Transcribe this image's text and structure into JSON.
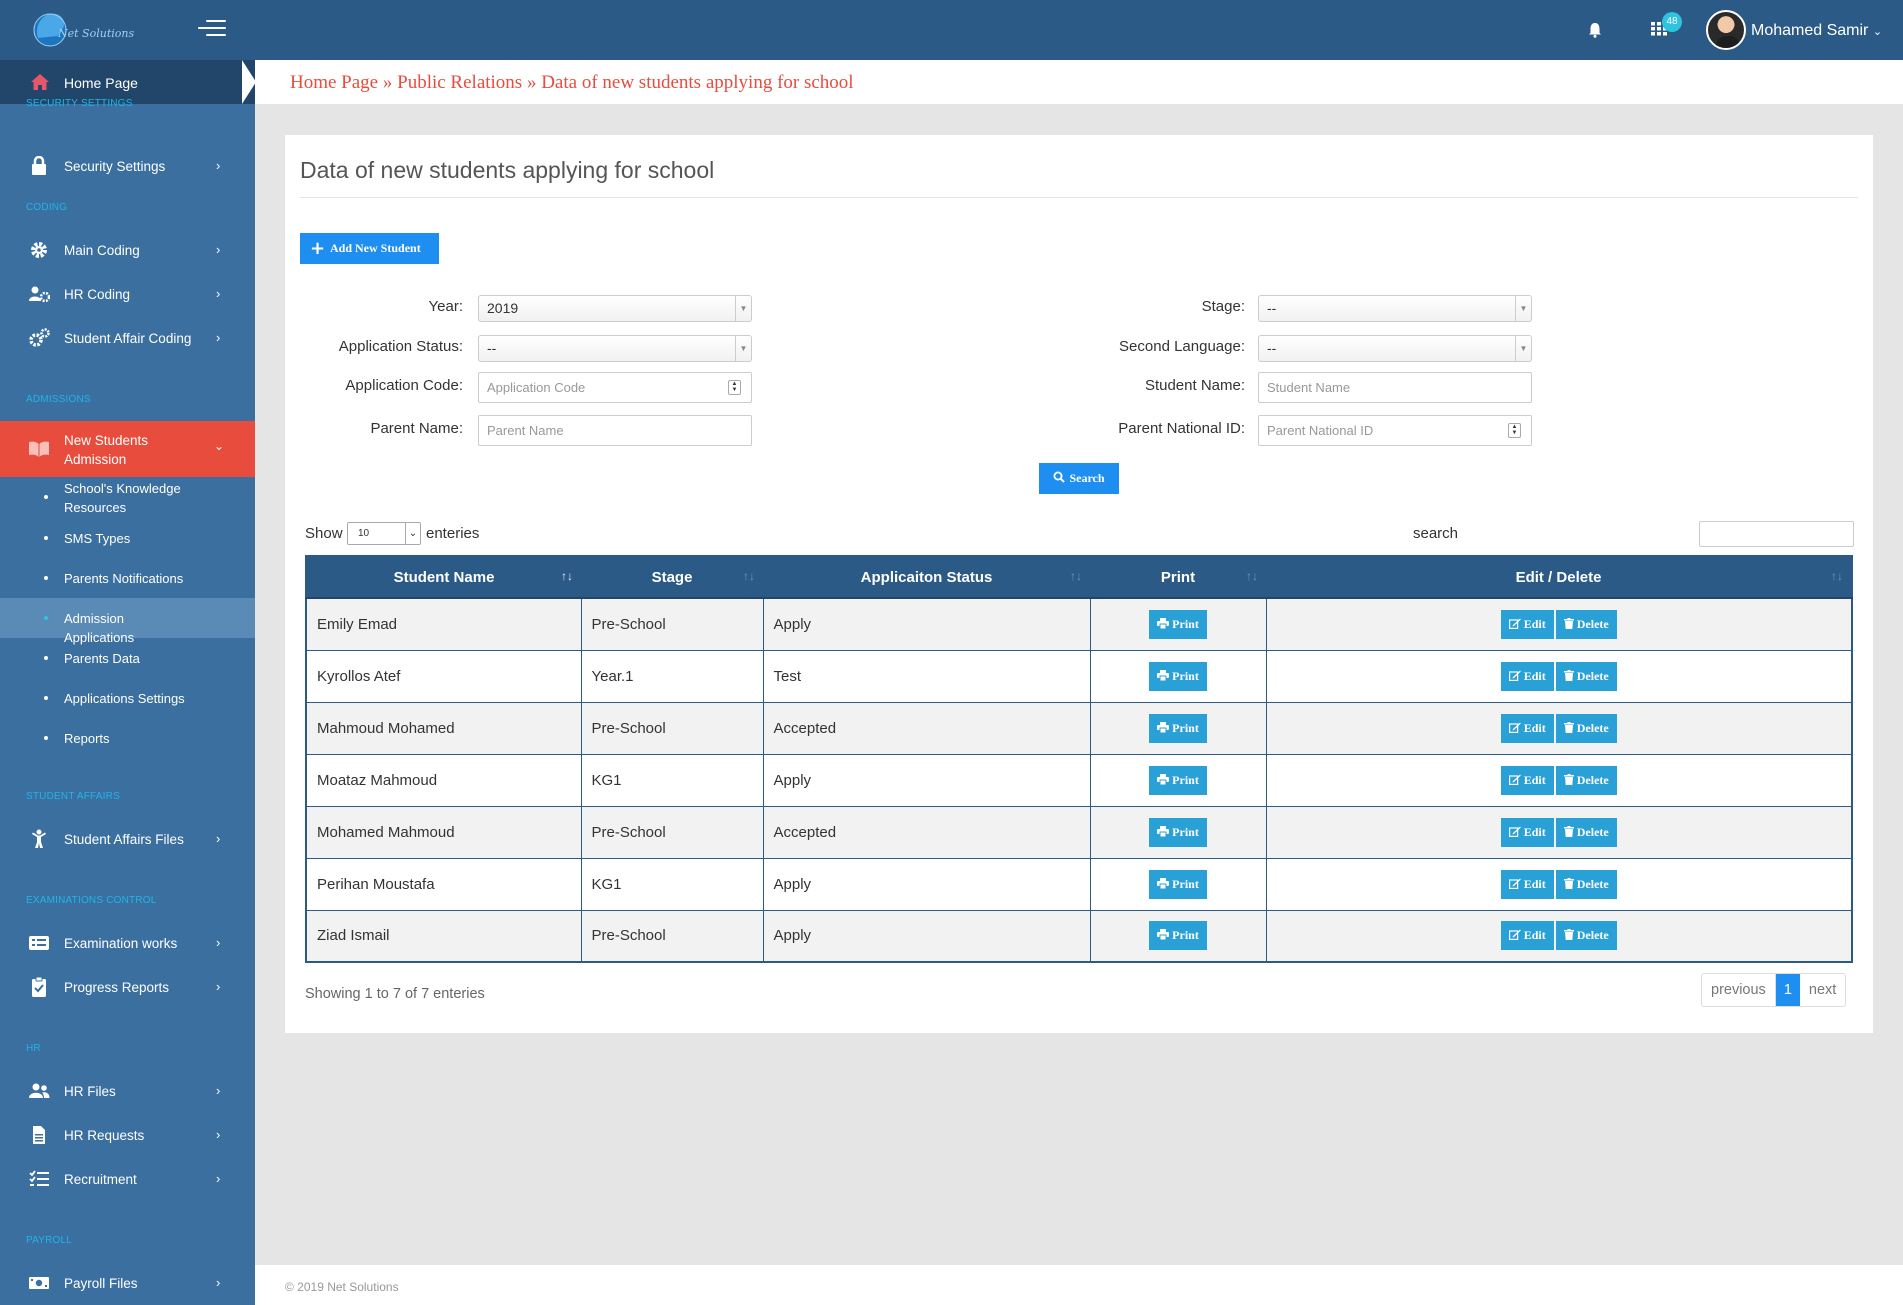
{
  "brand": {
    "name": "Net Solutions",
    "logo_icon": "globe-head-logo"
  },
  "header": {
    "notification_icon": "bell-icon",
    "apps_icon": "grid-icon",
    "apps_badge": "48",
    "user_name": "Mohamed Samir",
    "user_menu_icon": "chevron-down-icon"
  },
  "sidebar": {
    "home": {
      "label": "Home Page",
      "icon": "home-icon"
    },
    "sections": {
      "security": "SECURITY SETTINGS",
      "coding": "CODING",
      "admissions": "ADMISSIONS",
      "student_affairs": "STUDENT AFFAIRS",
      "examinations": "EXAMINATIONS CONTROL",
      "hr": "HR",
      "payroll": "PAYROLL"
    },
    "items": {
      "security_settings": "Security Settings",
      "main_coding": "Main Coding",
      "hr_coding": "HR Coding",
      "student_affair_coding": "Student Affair Coding",
      "new_students_admission": "New Students Admission",
      "student_affairs_files": "Student Affairs Files",
      "examination_works": "Examination works",
      "progress_reports": "Progress Reports",
      "hr_files": "HR Files",
      "hr_requests": "HR Requests",
      "recruitment": "Recruitment",
      "payroll_files": "Payroll Files"
    },
    "subitems": {
      "knowledge": "School's Knowledge Resources",
      "sms": "SMS Types",
      "notifications": "Parents Notifications",
      "applications": "Admission Applications",
      "parents_data": "Parents Data",
      "app_settings": "Applications Settings",
      "reports": "Reports"
    }
  },
  "breadcrumb": {
    "home": "Home Page",
    "sep": "»",
    "public_relations": "Public Relations",
    "current": "Data of new students applying for school"
  },
  "page": {
    "title": "Data of new students applying for school",
    "add_button": "Add New Student",
    "search_button": "Search"
  },
  "filters": {
    "year": {
      "label": "Year:",
      "value": "2019"
    },
    "stage": {
      "label": "Stage:",
      "value": "--"
    },
    "application_status": {
      "label": "Application Status:",
      "value": "--"
    },
    "second_language": {
      "label": "Second Language:",
      "value": "--"
    },
    "application_code": {
      "label": "Application Code:",
      "placeholder": "Application Code"
    },
    "student_name": {
      "label": "Student Name:",
      "placeholder": "Student Name"
    },
    "parent_name": {
      "label": "Parent Name:",
      "placeholder": "Parent Name"
    },
    "parent_national_id": {
      "label": "Parent National ID:",
      "placeholder": "Parent National ID"
    }
  },
  "table_controls": {
    "show_label": "Show",
    "page_size": "10",
    "enteries_label": "enteries",
    "search_label": "search"
  },
  "table": {
    "columns": [
      "Student Name",
      "Stage",
      "Applicaiton Status",
      "Print",
      "Edit / Delete"
    ],
    "print_label": "Print",
    "edit_label": "Edit",
    "delete_label": "Delete",
    "rows": [
      {
        "name": "Emily Emad",
        "stage": "Pre-School",
        "status": "Apply"
      },
      {
        "name": "Kyrollos Atef",
        "stage": "Year.1",
        "status": "Test"
      },
      {
        "name": "Mahmoud Mohamed",
        "stage": "Pre-School",
        "status": "Accepted"
      },
      {
        "name": "Moataz Mahmoud",
        "stage": "KG1",
        "status": "Apply"
      },
      {
        "name": "Mohamed Mahmoud",
        "stage": "Pre-School",
        "status": "Accepted"
      },
      {
        "name": "Perihan Moustafa",
        "stage": "KG1",
        "status": "Apply"
      },
      {
        "name": "Ziad Ismail",
        "stage": "Pre-School",
        "status": "Apply"
      }
    ]
  },
  "pagination": {
    "summary": "Showing 1 to 7 of 7 enteries",
    "previous": "previous",
    "current": "1",
    "next": "next"
  },
  "footer": {
    "copyright": "© 2019 Net Solutions"
  },
  "colors": {
    "topbar": "#2b5a87",
    "sidebar": "#3b6f9f",
    "active": "#e84c3d",
    "primary": "#1e8ff0",
    "row_button": "#2aa1d6"
  }
}
